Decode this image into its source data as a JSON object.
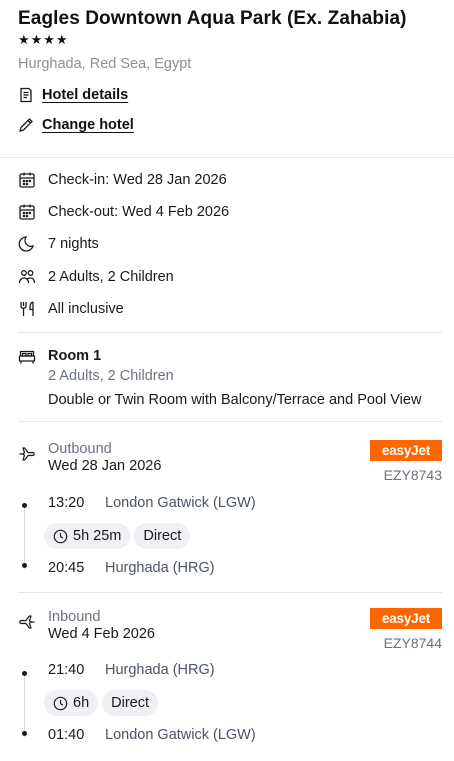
{
  "hotel": {
    "name": "Eagles Downtown Aqua Park (Ex. Zahabia)",
    "stars": "★★★★",
    "location": "Hurghada, Red Sea, Egypt",
    "details_link": "Hotel details",
    "change_link": "Change hotel"
  },
  "stay": {
    "checkin": "Check-in: Wed 28 Jan 2026",
    "checkout": "Check-out: Wed 4 Feb 2026",
    "nights": "7 nights",
    "guests": "2 Adults, 2 Children",
    "board": "All inclusive"
  },
  "room": {
    "title": "Room 1",
    "guests": "2 Adults, 2 Children",
    "description": "Double or Twin Room with Balcony/Terrace and Pool View"
  },
  "outbound": {
    "label": "Outbound",
    "date": "Wed 28 Jan 2026",
    "airline": "easyJet",
    "flight_no": "EZY8743",
    "depart_time": "13:20",
    "depart_airport": "London Gatwick (LGW)",
    "duration": "5h 25m",
    "stops": "Direct",
    "arrive_time": "20:45",
    "arrive_airport": "Hurghada (HRG)"
  },
  "inbound": {
    "label": "Inbound",
    "date": "Wed 4 Feb 2026",
    "airline": "easyJet",
    "flight_no": "EZY8744",
    "depart_time": "21:40",
    "depart_airport": "Hurghada (HRG)",
    "duration": "6h",
    "stops": "Direct",
    "arrive_time": "01:40",
    "arrive_airport": "London Gatwick (LGW)"
  },
  "colors": {
    "airline_brand": "#ff6600",
    "muted_text": "#6b7280",
    "chip_bg": "#eef0f3"
  },
  "icons": {
    "hotel_details": "document-icon",
    "change_hotel": "pencil-icon",
    "checkin": "calendar-icon",
    "checkout": "calendar-icon",
    "nights": "moon-icon",
    "guests": "people-icon",
    "board": "cutlery-icon",
    "room": "bed-icon",
    "outbound": "plane-departure-icon",
    "inbound": "plane-arrival-icon",
    "duration": "clock-icon"
  }
}
